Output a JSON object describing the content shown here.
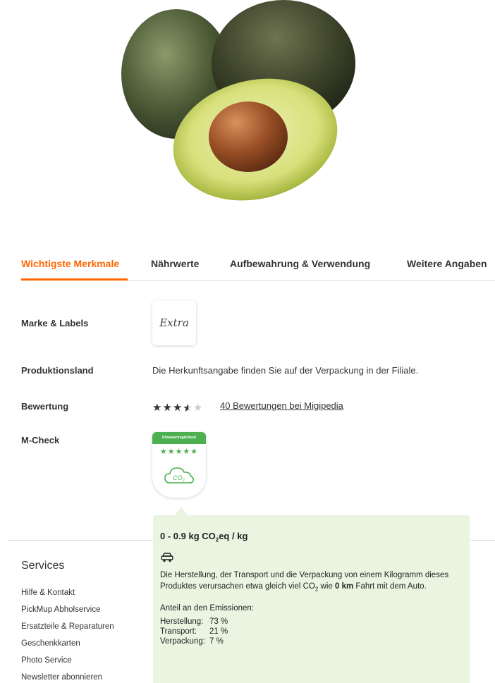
{
  "tabs": [
    {
      "label": "Wichtigste Merkmale",
      "active": true
    },
    {
      "label": "Nährwerte",
      "active": false
    },
    {
      "label": "Aufbewahrung & Verwendung",
      "active": false
    },
    {
      "label": "Weitere Angaben",
      "active": false
    }
  ],
  "features": {
    "brand": {
      "label": "Marke & Labels",
      "logo_text": "Extra"
    },
    "country": {
      "label": "Produktionsland",
      "value": "Die Herkunftsangabe finden Sie auf der Verpackung in der Filiale."
    },
    "rating": {
      "label": "Bewertung",
      "stars": 3.5,
      "max_stars": 5,
      "link_text": "40 Bewertungen bei Migipedia"
    },
    "mcheck": {
      "label": "M-Check",
      "badge_title": "Klimaverträglichkeit",
      "badge_stars": 5,
      "badge_icon": "co2-cloud-icon"
    }
  },
  "popover": {
    "heading_pre": "0 - 0.9 kg CO",
    "heading_sub": "2",
    "heading_post": "eq / kg",
    "icon": "car-icon",
    "text_1": "Die Herstellung, der Transport und die Verpackung von einem Kilogramm dieses Produktes verursachen etwa gleich viel CO",
    "text_sub": "2",
    "text_2": " wie ",
    "text_bold": "0 km",
    "text_3": " Fahrt mit dem Auto.",
    "share_title": "Anteil an den Emissionen:",
    "breakdown": [
      {
        "label": "Herstellung:",
        "value": "73 %"
      },
      {
        "label": "Transport:",
        "value": "21 %"
      },
      {
        "label": "Verpackung:",
        "value": "7 %"
      }
    ]
  },
  "footer": {
    "services_title": "Services",
    "links": [
      "Hilfe & Kontakt",
      "PickMup Abholservice",
      "Ersatzteile & Reparaturen",
      "Geschenkkarten",
      "Photo Service",
      "Newsletter abonnieren"
    ]
  },
  "colors": {
    "accent": "#ff6600",
    "green": "#4caf50",
    "popover_bg": "#e9f5e1"
  }
}
